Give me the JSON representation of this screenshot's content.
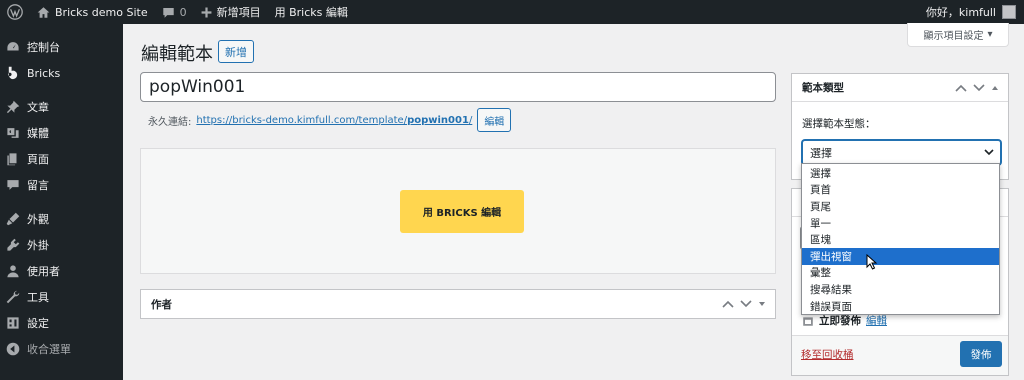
{
  "adminbar": {
    "site_name": "Bricks demo Site",
    "comments_count": "0",
    "new_item": "新增項目",
    "bricks_edit": "用 Bricks 編輯",
    "greeting": "你好，kimfull"
  },
  "menu": {
    "items": [
      {
        "label": "控制台",
        "icon": "dashboard-icon"
      },
      {
        "label": "Bricks",
        "icon": "bricks-logo-icon"
      },
      {
        "label": "文章",
        "icon": "pushpin-icon"
      },
      {
        "label": "媒體",
        "icon": "media-icon"
      },
      {
        "label": "頁面",
        "icon": "pages-icon"
      },
      {
        "label": "留言",
        "icon": "comments-icon"
      },
      {
        "label": "外觀",
        "icon": "appearance-icon"
      },
      {
        "label": "外掛",
        "icon": "plugins-icon"
      },
      {
        "label": "使用者",
        "icon": "users-icon"
      },
      {
        "label": "工具",
        "icon": "tools-icon"
      },
      {
        "label": "設定",
        "icon": "settings-icon"
      }
    ],
    "collapse": "收合選單"
  },
  "page": {
    "title": "編輯範本",
    "add_new": "新增",
    "screen_options": "顯示項目設定",
    "post_title": "popWin001"
  },
  "permalink": {
    "label": "永久連結:",
    "url_prefix": "https://bricks-demo.kimfull.com/template/",
    "slug": "popwin001",
    "url_suffix": "/",
    "edit": "編輯"
  },
  "editor": {
    "bricks_button": "用 BRICKS 編輯"
  },
  "author_box": {
    "title": "作者"
  },
  "template_type": {
    "title": "範本類型",
    "label": "選擇範本型態：",
    "selected": "選擇",
    "options": [
      "選擇",
      "頁首",
      "頁尾",
      "單一",
      "區塊",
      "彈出視窗",
      "彙整",
      "搜尋結果",
      "錯誤頁面"
    ],
    "highlighted_index": 5
  },
  "publish": {
    "publish_immediately_prefix": "立即發佈",
    "edit_link": "編輯",
    "trash": "移至回收桶",
    "publish_button": "發佈"
  },
  "colors": {
    "adminbar_bg": "#1d2327",
    "accent": "#2271b1",
    "bricks_yellow": "#ffd64f",
    "highlight": "#1e6fcc",
    "trash_red": "#b32d2e"
  }
}
